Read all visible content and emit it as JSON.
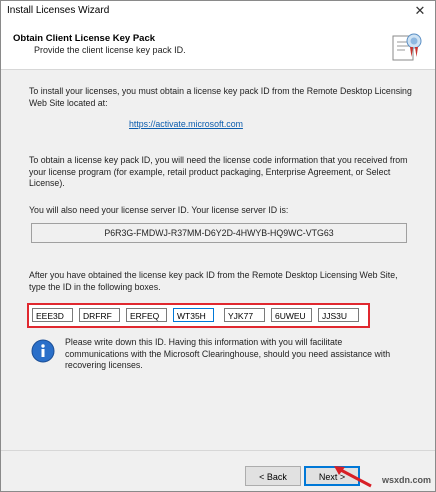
{
  "window": {
    "title": "Install Licenses Wizard",
    "close_glyph": "✕"
  },
  "header": {
    "title": "Obtain Client License Key Pack",
    "subtitle": "Provide the client license key pack ID."
  },
  "content": {
    "intro": "To install your licenses, you must obtain a license key pack ID from the Remote Desktop Licensing Web Site located at:",
    "link": "https://activate.microsoft.com",
    "code_info": "To obtain a license key pack ID, you will need the license code information that you received from your license program (for example, retail product packaging, Enterprise Agreement, or Select License).",
    "server_id_label": "You will also need your license server ID. Your license server ID is:",
    "server_id": "P6R3G-FMDWJ-R37MM-D6Y2D-4HWYB-HQ9WC-VTG63",
    "type_instructions": "After you have obtained the license key pack ID from the Remote Desktop Licensing Web Site, type the ID in the following boxes.",
    "key_fields": [
      "EEE3D",
      "DRFRF",
      "ERFEQ",
      "WT35H",
      "YJK77",
      "6UWEU",
      "JJS3U"
    ],
    "note": "Please write down this ID. Having this information with you will facilitate communications with the Microsoft Clearinghouse, should you need assistance with recovering licenses."
  },
  "footer": {
    "back_label": "< Back",
    "next_label": "Next >"
  },
  "watermark": "wsxdn.com",
  "colors": {
    "highlight": "#e0282f",
    "link": "#0b5cad",
    "accent": "#0078d7"
  }
}
